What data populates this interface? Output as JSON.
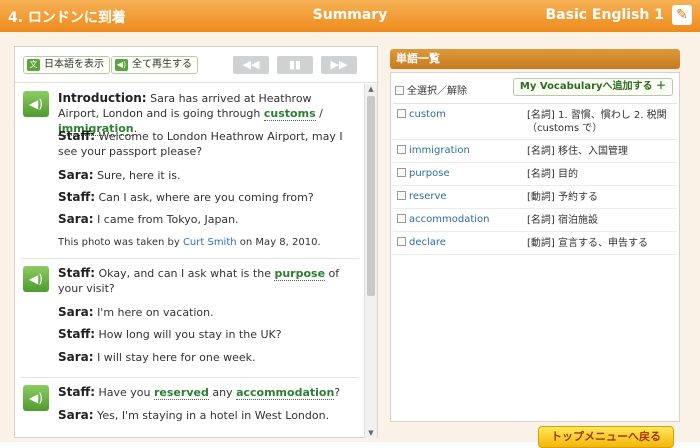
{
  "header": {
    "lesson_title": "4. ロンドンに到着",
    "page_title": "Summary",
    "course_title": "Basic English 1"
  },
  "toolbar": {
    "show_japanese": "日本語を表示",
    "play_all": "全て再生する",
    "rewind": "◀◀",
    "pause": "▮▮",
    "forward": "▶▶"
  },
  "dialogue": {
    "block1": {
      "intro_speaker": "Introduction:",
      "intro_text": "Sara has arrived at Heathrow Airport, London and is going through",
      "kw1": "customs",
      "slash": "/",
      "kw2": "immigration",
      "period": ".",
      "l1_speaker": "Staff:",
      "l1_text": "Welcome to London Heathrow Airport, may I see your passport please?",
      "l2_speaker": "Sara:",
      "l2_text": "Sure, here it is.",
      "l3_speaker": "Staff:",
      "l3_text": "Can I ask, where are you coming from?",
      "l4_speaker": "Sara:",
      "l4_text": "I came from Tokyo, Japan.",
      "photo_pre": "This photo was taken by",
      "photo_author": "Curt Smith",
      "photo_post": "on May 8, 2010."
    },
    "block2": {
      "l1_speaker": "Staff:",
      "l1_pre": "Okay, and can I ask what is the",
      "l1_kw": "purpose",
      "l1_post": "of your visit?",
      "l2_speaker": "Sara:",
      "l2_text": "I'm here on vacation.",
      "l3_speaker": "Staff:",
      "l3_text": "How long will you stay in the UK?",
      "l4_speaker": "Sara:",
      "l4_text": "I will stay here for one week."
    },
    "block3": {
      "l1_speaker": "Staff:",
      "l1_pre": "Have you",
      "l1_kw1": "reserved",
      "l1_mid": "any",
      "l1_kw2": "accommodation",
      "l1_post": "?",
      "l2_speaker": "Sara:",
      "l2_text": "Yes, I'm staying in a hotel in West London."
    }
  },
  "vocab": {
    "title": "単語一覧",
    "select_all": "全選択／解除",
    "my_vocab_button": "My Vocabularyへ追加する ＋",
    "items": [
      {
        "word": "custom",
        "def": "[名詞] 1. 習慣、慣わし 2. 税関（customs で）"
      },
      {
        "word": "immigration",
        "def": "[名詞] 移住、入国管理"
      },
      {
        "word": "purpose",
        "def": "[名詞] 目的"
      },
      {
        "word": "reserve",
        "def": "[動詞] 予約する"
      },
      {
        "word": "accommodation",
        "def": "[名詞] 宿泊施設"
      },
      {
        "word": "declare",
        "def": "[動詞] 宣言する、申告する"
      }
    ]
  },
  "top_menu_button": "トップメニューへ戻る"
}
